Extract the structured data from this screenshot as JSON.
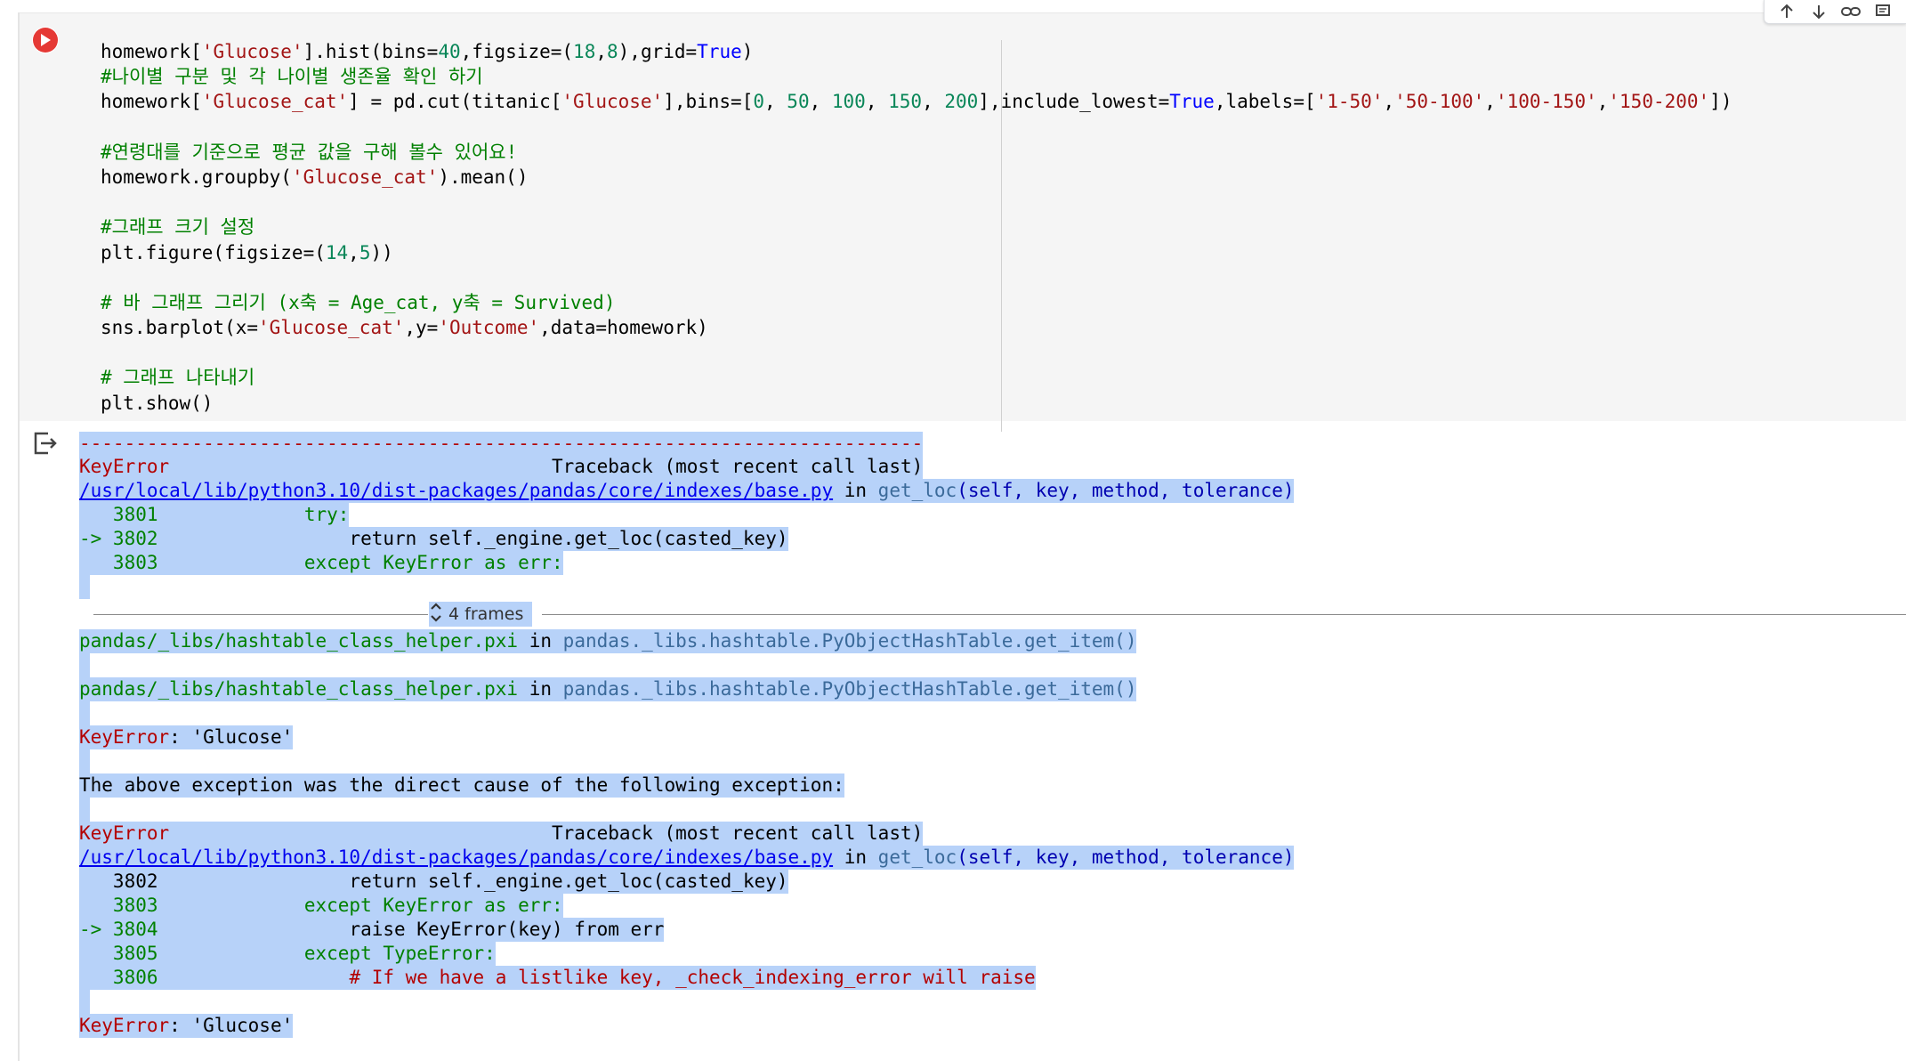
{
  "toolbar": {
    "icons": [
      "arrow-up-icon",
      "arrow-down-icon",
      "link-icon",
      "comment-icon"
    ]
  },
  "code": {
    "lines": [
      "homework['Glucose'].hist(bins=40,figsize=(18,8),grid=True)",
      "#나이별 구분 및 각 나이별 생존율 확인 하기",
      "homework['Glucose_cat'] = pd.cut(titanic['Glucose'],bins=[0, 50, 100, 150, 200],include_lowest=True,labels=['1-50','50-100','100-150','150-200'])",
      "",
      "#연령대를 기준으로 평균 값을 구해 볼수 있어요!",
      "homework.groupby('Glucose_cat').mean()",
      "",
      "#그래프 크기 설정",
      "plt.figure(figsize=(14,5))",
      "",
      "# 바 그래프 그리기 (x축 = Age_cat, y축 = Survived)",
      "sns.barplot(x='Glucose_cat',y='Outcome',data=homework)",
      "",
      "# 그래프 나타내기",
      "plt.show()"
    ]
  },
  "output": {
    "dashes": "---------------------------------------------------------------------------",
    "tb1": {
      "err_name": "KeyError",
      "header": "                                  Traceback (most recent call last)",
      "file": "/usr/local/lib/python3.10/dist-packages/pandas/core/indexes/base.py",
      "in": " in ",
      "func": "get_loc",
      "args": "(self, key, method, tolerance)",
      "l1": "   3801             try:",
      "l2_arrow": "-> 3802",
      "l2_code": "                 return self._engine.get_loc(casted_key)",
      "l3": "   3803             except KeyError as err:"
    },
    "frames_label": "4 frames",
    "hash1_file": "pandas/_libs/hashtable_class_helper.pxi",
    "hash1_in": " in ",
    "hash1_func": "pandas._libs.hashtable.PyObjectHashTable.get_item()",
    "hash2_file": "pandas/_libs/hashtable_class_helper.pxi",
    "hash2_in": " in ",
    "hash2_func": "pandas._libs.hashtable.PyObjectHashTable.get_item()",
    "keyerror1_name": "KeyError",
    "keyerror1_msg": ": 'Glucose'",
    "cause_msg": "The above exception was the direct cause of the following exception:",
    "tb2": {
      "err_name": "KeyError",
      "header": "                                  Traceback (most recent call last)",
      "file": "/usr/local/lib/python3.10/dist-packages/pandas/core/indexes/base.py",
      "in": " in ",
      "func": "get_loc",
      "args": "(self, key, method, tolerance)",
      "l1": "   3802                 return self._engine.get_loc(casted_key)",
      "l2": "   3803             except KeyError as err:",
      "l3_arrow": "-> 3804",
      "l3_code": "                 raise KeyError(key) from err",
      "l4": "   3805             except TypeError:",
      "l5_num": "   3806",
      "l5_code": "                 # If we have a listlike key, _check_indexing_error will raise"
    },
    "keyerror2_name": "KeyError",
    "keyerror2_msg": ": 'Glucose'"
  }
}
